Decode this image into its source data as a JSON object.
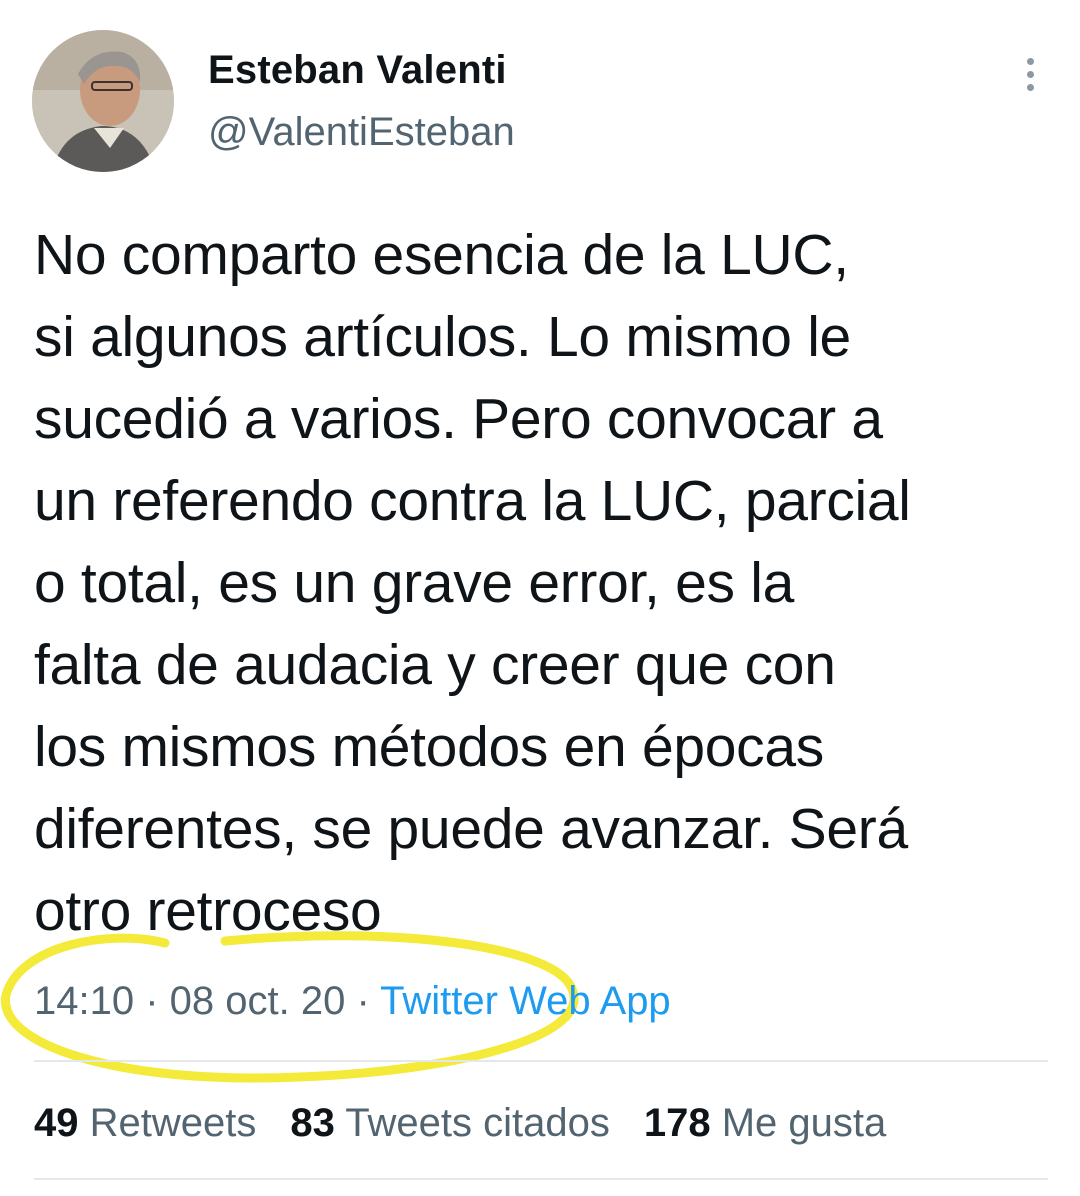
{
  "author": {
    "display_name": "Esteban Valenti",
    "handle": "@ValentiEsteban"
  },
  "tweet": {
    "text": "No comparto esencia de la LUC,\nsi algunos artículos. Lo mismo le\nsucedió a varios. Pero convocar a\nun referendo contra la LUC, parcial\no total, es un grave error, es la\nfalta de audacia y creer que con\nlos mismos métodos en épocas\ndiferentes, se puede avanzar. Será\notro retroceso"
  },
  "meta": {
    "time": "14:10",
    "separator": " · ",
    "date": "08 oct. 20",
    "source": "Twitter Web App"
  },
  "stats": {
    "retweets_count": "49",
    "retweets_label": "Retweets",
    "quotes_count": "83",
    "quotes_label": "Tweets citados",
    "likes_count": "178",
    "likes_label": "Me gusta"
  },
  "icons": {
    "more": "more-vertical-icon"
  },
  "colors": {
    "text": "#0f1419",
    "secondary": "#536471",
    "link": "#1d9bf0",
    "highlight": "#f3ea3a",
    "divider": "#e5e8eb"
  }
}
